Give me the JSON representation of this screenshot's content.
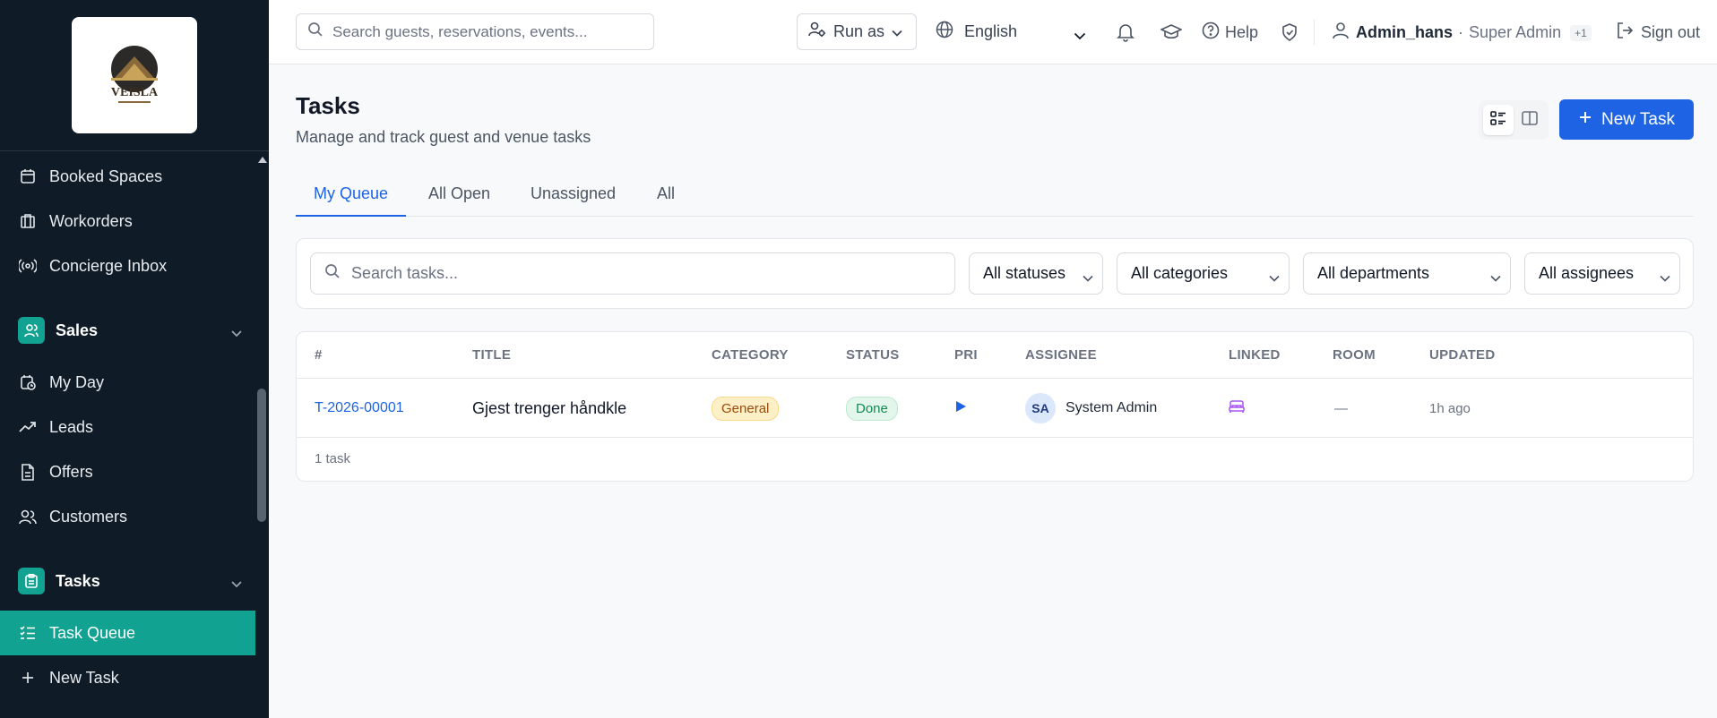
{
  "sidebar": {
    "logo_text": "VEISLA",
    "items_top": [
      {
        "label": "Booked Spaces",
        "icon": "calendar-icon"
      },
      {
        "label": "Workorders",
        "icon": "building-icon"
      },
      {
        "label": "Concierge Inbox",
        "icon": "broadcast-icon"
      }
    ],
    "group_sales": {
      "label": "Sales",
      "icon": "users-icon"
    },
    "items_sales": [
      {
        "label": "My Day",
        "icon": "calendar-clock-icon"
      },
      {
        "label": "Leads",
        "icon": "trending-up-icon"
      },
      {
        "label": "Offers",
        "icon": "document-icon"
      },
      {
        "label": "Customers",
        "icon": "users-icon"
      }
    ],
    "group_tasks": {
      "label": "Tasks",
      "icon": "clipboard-icon"
    },
    "items_tasks": [
      {
        "label": "Task Queue",
        "icon": "list-check-icon",
        "active": true
      },
      {
        "label": "New Task",
        "icon": "plus-icon"
      }
    ]
  },
  "topbar": {
    "search_placeholder": "Search guests, reservations, events...",
    "run_as": "Run as",
    "language": "English",
    "help": "Help",
    "user_name": "Admin_hans",
    "separator": "·",
    "role": "Super Admin",
    "role_extra": "+1",
    "sign_out": "Sign out"
  },
  "page": {
    "title": "Tasks",
    "subtitle": "Manage and track guest and venue tasks",
    "new_task": "New Task"
  },
  "tabs": [
    "My Queue",
    "All Open",
    "Unassigned",
    "All"
  ],
  "filters": {
    "search_placeholder": "Search tasks...",
    "status": "All statuses",
    "category": "All categories",
    "department": "All departments",
    "assignee": "All assignees"
  },
  "table": {
    "columns": [
      "#",
      "TITLE",
      "CATEGORY",
      "STATUS",
      "PRI",
      "ASSIGNEE",
      "LINKED",
      "ROOM",
      "UPDATED"
    ],
    "rows": [
      {
        "id": "T-2026-00001",
        "title": "Gjest trenger håndkle",
        "category": "General",
        "status": "Done",
        "priority_icon": "play-icon",
        "assignee_initials": "SA",
        "assignee": "System Admin",
        "linked_icon": "bed-icon",
        "room": "—",
        "updated": "1h ago"
      }
    ],
    "count_label": "1 task"
  },
  "colors": {
    "sidebar_bg": "#0f1b26",
    "accent_teal": "#11a291",
    "primary_blue": "#1d63e3"
  }
}
